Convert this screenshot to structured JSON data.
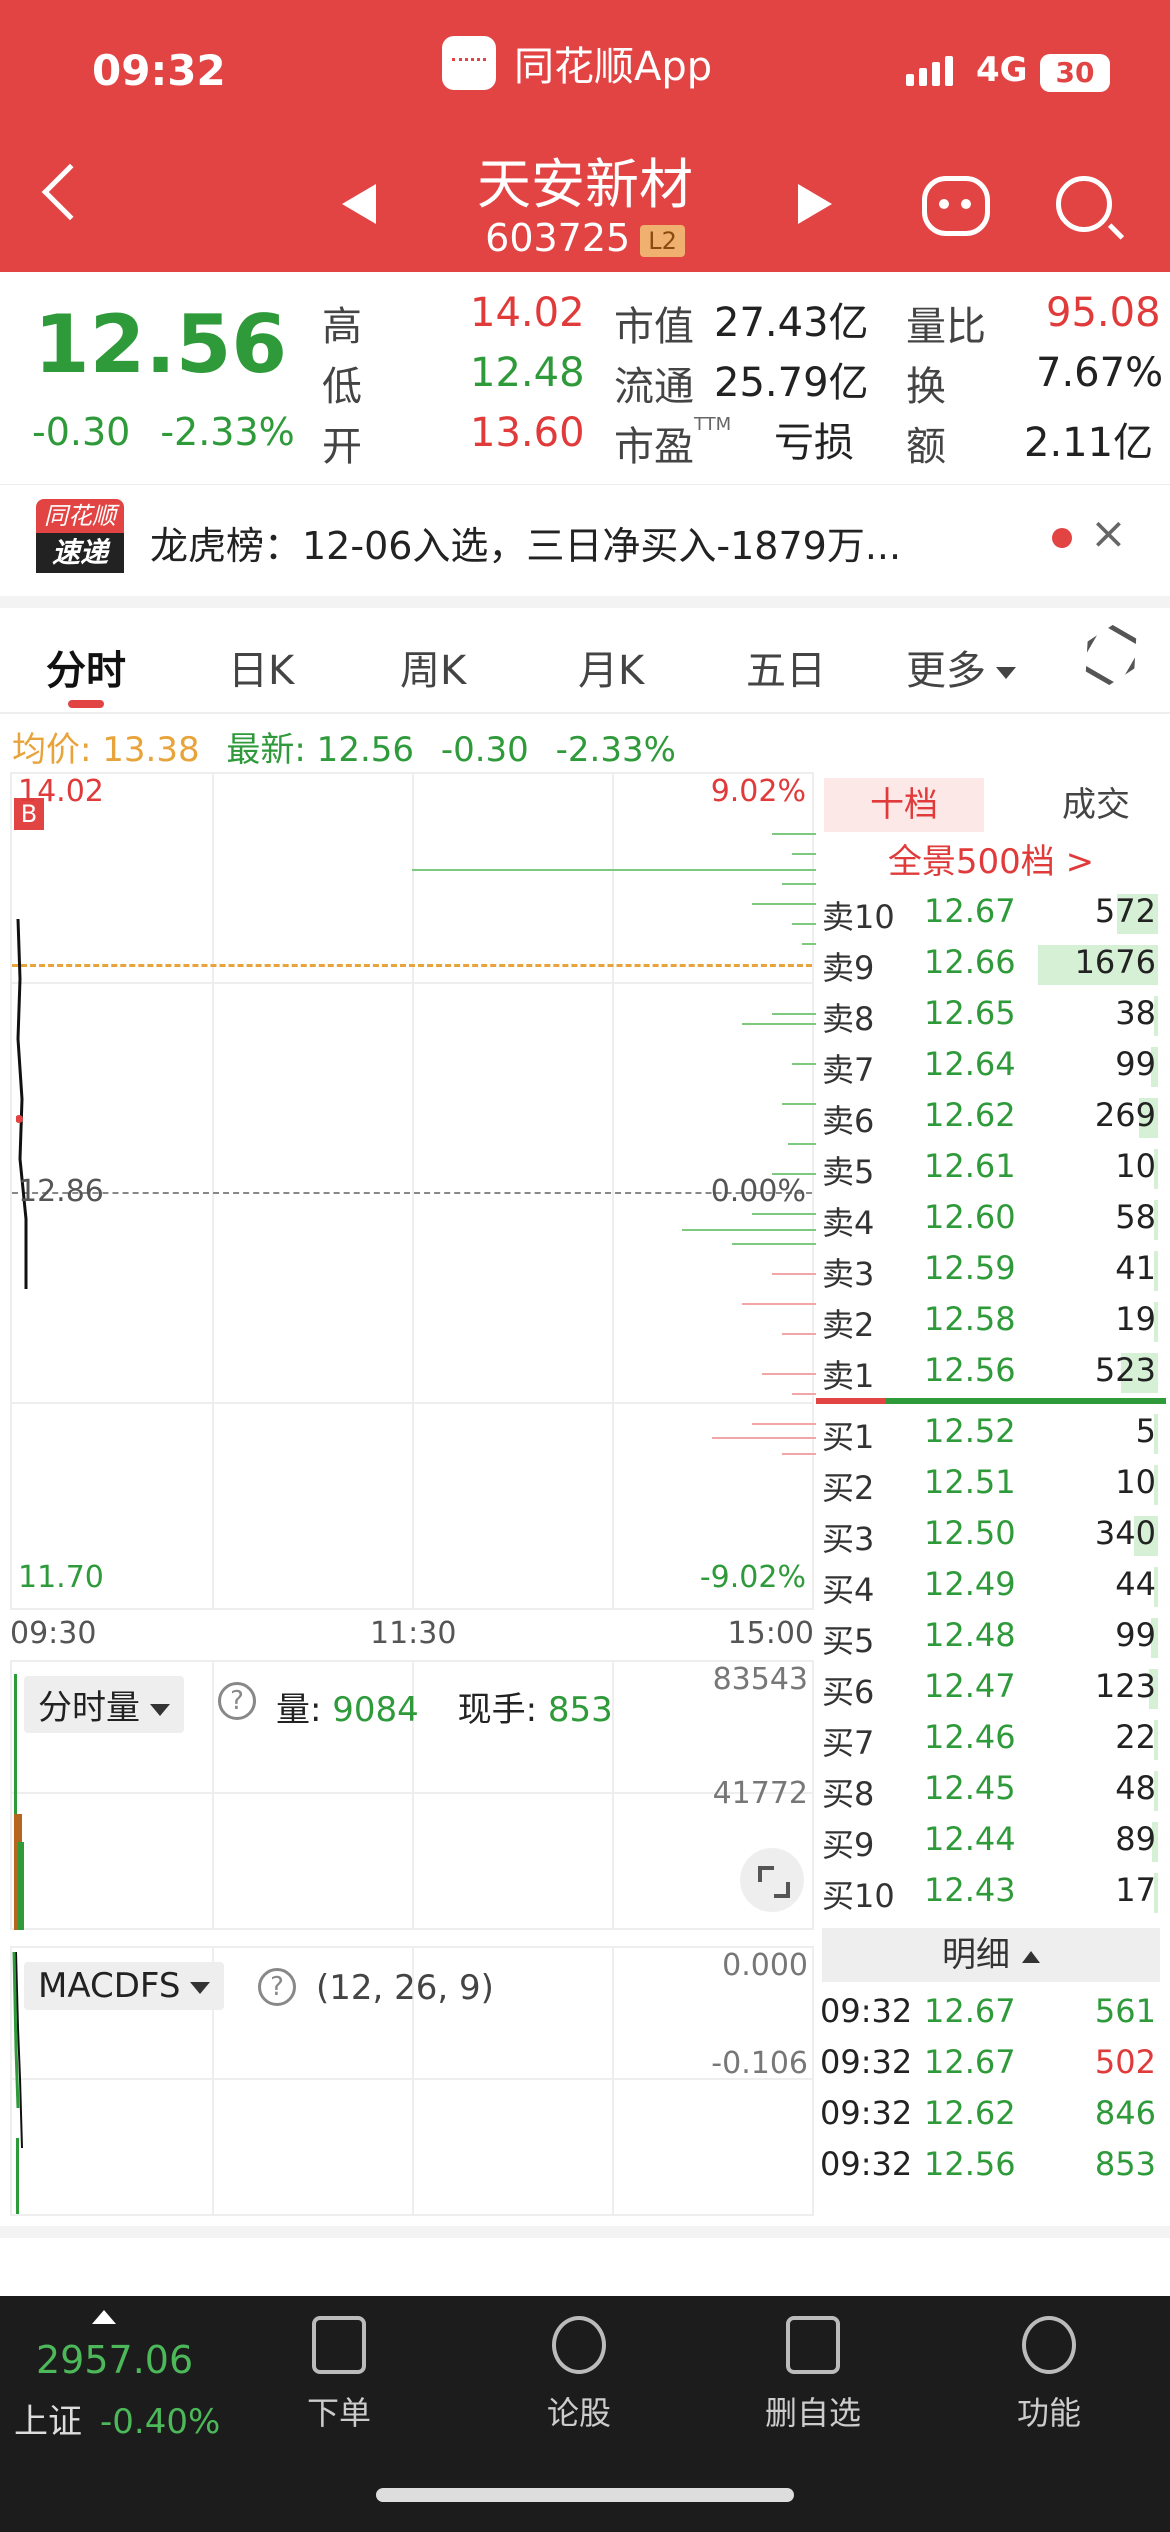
{
  "status_bar": {
    "time": "09:32",
    "app_name": "同花顺App",
    "network": "4G",
    "battery": "30"
  },
  "header": {
    "stock_name": "天安新材",
    "stock_code": "603725",
    "level_badge": "L2"
  },
  "quote": {
    "last_price": "12.56",
    "change": "-0.30",
    "change_pct": "-2.33%",
    "rows": [
      {
        "l1": "高",
        "v1": "14.02",
        "l2": "市值",
        "v2": "27.43亿",
        "l3": "量比",
        "v3": "95.08"
      },
      {
        "l1": "低",
        "v1": "12.48",
        "l2": "流通",
        "v2": "25.79亿",
        "l3": "换",
        "v3": "7.67%"
      },
      {
        "l1": "开",
        "v1": "13.60",
        "l2": "市盈",
        "v2": "亏损",
        "l3": "额",
        "v3": "2.11亿"
      }
    ],
    "pe_superscript": "TTM"
  },
  "banner": {
    "logo_top": "同花顺",
    "logo_bottom": "速递",
    "text": "龙虎榜：12-06入选，三日净买入-1879万..."
  },
  "tabs": [
    "分时",
    "日K",
    "周K",
    "月K",
    "五日",
    "更多"
  ],
  "summary": {
    "avg_label": "均价: 13.38",
    "latest_label": "最新: 12.56",
    "change": "-0.30",
    "change_pct": "-2.33%"
  },
  "chart": {
    "high": "14.02",
    "high_pct": "9.02%",
    "prev_close": "12.86",
    "zero_pct": "0.00%",
    "low": "11.70",
    "low_pct": "-9.02%",
    "buy_marker": "B",
    "time_start": "09:30",
    "time_mid": "11:30",
    "time_end": "15:00"
  },
  "volume_panel": {
    "selector": "分时量",
    "vol_label": "量:",
    "vol_value": "9084",
    "hand_label": "现手:",
    "hand_value": "853",
    "max": "83543",
    "mid": "41772"
  },
  "macd_panel": {
    "selector": "MACDFS",
    "params": "(12, 26, 9)",
    "top": "0.000",
    "mid": "-0.106"
  },
  "order_book": {
    "tab_ten": "十档",
    "tab_deals": "成交",
    "panorama": "全景500档 >",
    "asks": [
      {
        "label": "卖10",
        "price": "12.67",
        "qty": "572"
      },
      {
        "label": "卖9",
        "price": "12.66",
        "qty": "1676"
      },
      {
        "label": "卖8",
        "price": "12.65",
        "qty": "38"
      },
      {
        "label": "卖7",
        "price": "12.64",
        "qty": "99"
      },
      {
        "label": "卖6",
        "price": "12.62",
        "qty": "269"
      },
      {
        "label": "卖5",
        "price": "12.61",
        "qty": "10"
      },
      {
        "label": "卖4",
        "price": "12.60",
        "qty": "58"
      },
      {
        "label": "卖3",
        "price": "12.59",
        "qty": "41"
      },
      {
        "label": "卖2",
        "price": "12.58",
        "qty": "19"
      },
      {
        "label": "卖1",
        "price": "12.56",
        "qty": "523"
      }
    ],
    "bids": [
      {
        "label": "买1",
        "price": "12.52",
        "qty": "5"
      },
      {
        "label": "买2",
        "price": "12.51",
        "qty": "10"
      },
      {
        "label": "买3",
        "price": "12.50",
        "qty": "340"
      },
      {
        "label": "买4",
        "price": "12.49",
        "qty": "44"
      },
      {
        "label": "买5",
        "price": "12.48",
        "qty": "99"
      },
      {
        "label": "买6",
        "price": "12.47",
        "qty": "123"
      },
      {
        "label": "买7",
        "price": "12.46",
        "qty": "22"
      },
      {
        "label": "买8",
        "price": "12.45",
        "qty": "48"
      },
      {
        "label": "买9",
        "price": "12.44",
        "qty": "89"
      },
      {
        "label": "买10",
        "price": "12.43",
        "qty": "17"
      }
    ],
    "detail_header": "明细",
    "details": [
      {
        "time": "09:32",
        "price": "12.67",
        "vol": "561",
        "dir": "green"
      },
      {
        "time": "09:32",
        "price": "12.67",
        "vol": "502",
        "dir": "red"
      },
      {
        "time": "09:32",
        "price": "12.62",
        "vol": "846",
        "dir": "green"
      },
      {
        "time": "09:32",
        "price": "12.56",
        "vol": "853",
        "dir": "green"
      }
    ]
  },
  "bottom_nav": {
    "index_value": "2957.06",
    "index_name": "上证",
    "index_change": "-0.40%",
    "items": [
      "下单",
      "论股",
      "删自选",
      "功能"
    ]
  }
}
